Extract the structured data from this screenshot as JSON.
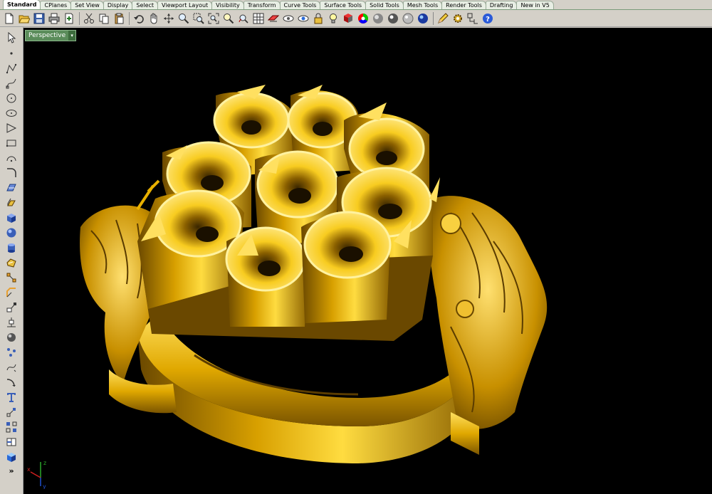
{
  "tabs": [
    "Standard",
    "CPlanes",
    "Set View",
    "Display",
    "Select",
    "Viewport Layout",
    "Visibility",
    "Transform",
    "Curve Tools",
    "Surface Tools",
    "Solid Tools",
    "Mesh Tools",
    "Render Tools",
    "Drafting",
    "New in V5"
  ],
  "toolbar_icons": [
    "new-file",
    "open-file",
    "save",
    "print",
    "import",
    "cut",
    "copy",
    "paste",
    "undo",
    "pan",
    "rotate-view",
    "zoom",
    "zoom-window",
    "zoom-extents",
    "zoom-selected",
    "undo-view",
    "grid",
    "set-cplane",
    "hide",
    "show",
    "lock",
    "light",
    "render-material",
    "color-wheel",
    "shaded",
    "rendered",
    "ghosted",
    "xray",
    "options",
    "properties",
    "help"
  ],
  "left_icons": [
    "select-arrow",
    "point",
    "polyline",
    "curve",
    "circle",
    "arc",
    "ellipse",
    "polygon",
    "rectangle",
    "freeform",
    "fillet",
    "surface-from-curves",
    "extrude",
    "box",
    "sphere",
    "cylinder",
    "boolean",
    "transform-move",
    "dimension",
    "text",
    "mesh",
    "analyze",
    "more"
  ],
  "viewport": {
    "label": "Perspective",
    "dropdown_glyph": "▾"
  },
  "axes": {
    "x": "x",
    "y": "y",
    "z": "z"
  },
  "more_glyph": "»",
  "colors": {
    "viewport_bg": "#000000",
    "gold": "#e0b000",
    "gold_dark": "#8a6400",
    "gold_light": "#ffe26a",
    "title_green": "#5a8c5a"
  }
}
